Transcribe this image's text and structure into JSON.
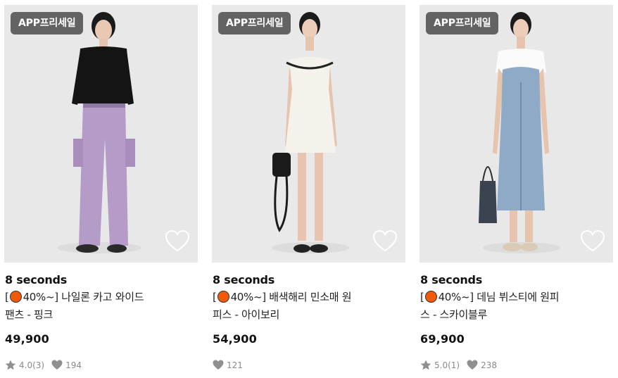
{
  "products": [
    {
      "badge": "APP프리세일",
      "brand": "8 seconds",
      "title_pre": "[",
      "title_rest": "40%~] 나일론 카고 와이드",
      "title_line2": "팬츠 - 핑크",
      "price": "49,900",
      "rating": "4.0(3)",
      "likes": "194",
      "colors": {
        "top": "#161616",
        "bottom": "#b59ac9",
        "shoe": "#2a2a2a"
      }
    },
    {
      "badge": "APP프리세일",
      "brand": "8 seconds",
      "title_pre": "[",
      "title_rest": "40%~] 배색해리 민소매 원",
      "title_line2": "피스 - 아이보리",
      "price": "54,900",
      "rating": "",
      "likes": "121",
      "colors": {
        "top": "#f4f1ea",
        "bottom": "#f4f1ea",
        "shoe": "#222222"
      }
    },
    {
      "badge": "APP프리세일",
      "brand": "8 seconds",
      "title_pre": "[",
      "title_rest": "40%~] 데님 뷔스티에 원피",
      "title_line2": "스 - 스카이블루",
      "price": "69,900",
      "rating": "5.0(1)",
      "likes": "238",
      "colors": {
        "top": "#8fa9c4",
        "bottom": "#8fa9c4",
        "shoe": "#d9cbb5"
      }
    }
  ],
  "icons": {
    "wishlist": "heart-outline-icon",
    "rating": "star-icon",
    "likes": "heart-filled-icon",
    "discount": "orange-dot-icon"
  }
}
